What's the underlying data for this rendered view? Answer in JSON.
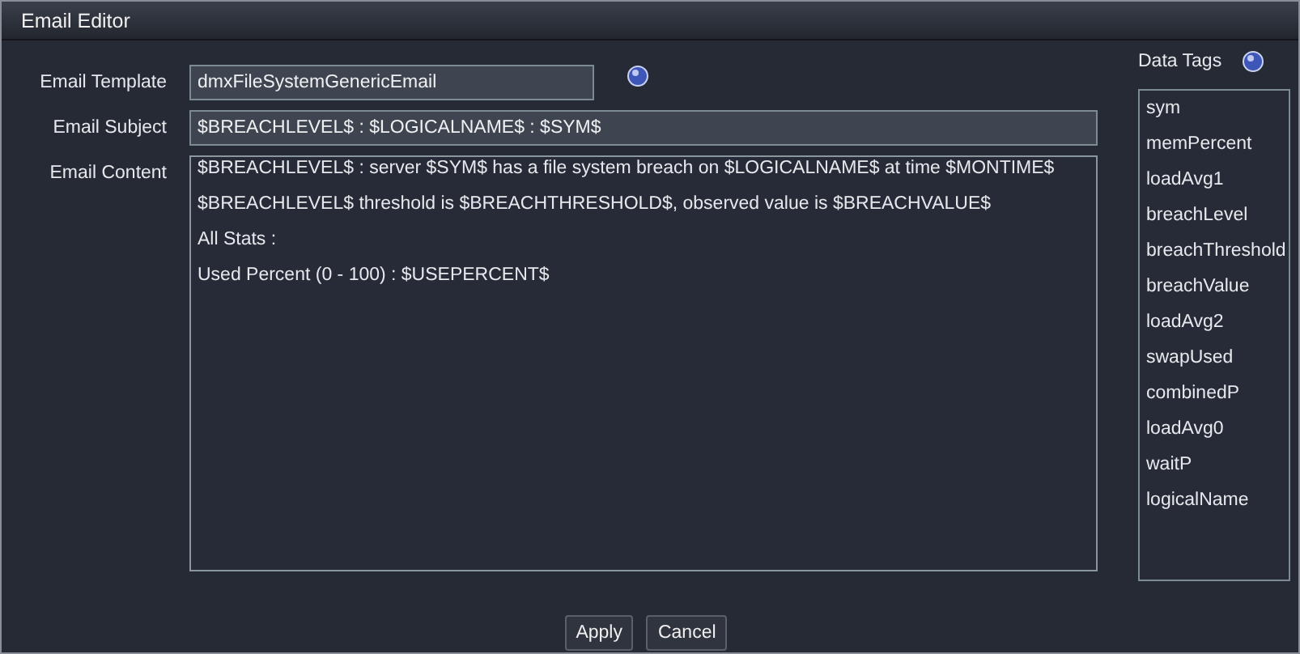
{
  "window": {
    "title": "Email Editor"
  },
  "form": {
    "template_label": "Email Template",
    "template_value": "dmxFileSystemGenericEmail",
    "subject_label": "Email Subject",
    "subject_value": "$BREACHLEVEL$ : $LOGICALNAME$ : $SYM$",
    "content_label": "Email Content",
    "content_lines": [
      "$BREACHLEVEL$ : server $SYM$ has a file system breach on $LOGICALNAME$ at time $MONTIME$",
      "$BREACHLEVEL$ threshold is $BREACHTHRESHOLD$, observed value is $BREACHVALUE$",
      "All Stats :",
      "Used Percent (0 - 100) : $USEPERCENT$"
    ]
  },
  "data_tags": {
    "label": "Data Tags",
    "items": [
      "sym",
      "memPercent",
      "loadAvg1",
      "breachLevel",
      "breachThreshold",
      "breachValue",
      "loadAvg2",
      "swapUsed",
      "combinedP",
      "loadAvg0",
      "waitP",
      "logicalName"
    ]
  },
  "buttons": [
    "Apply",
    "Cancel"
  ]
}
